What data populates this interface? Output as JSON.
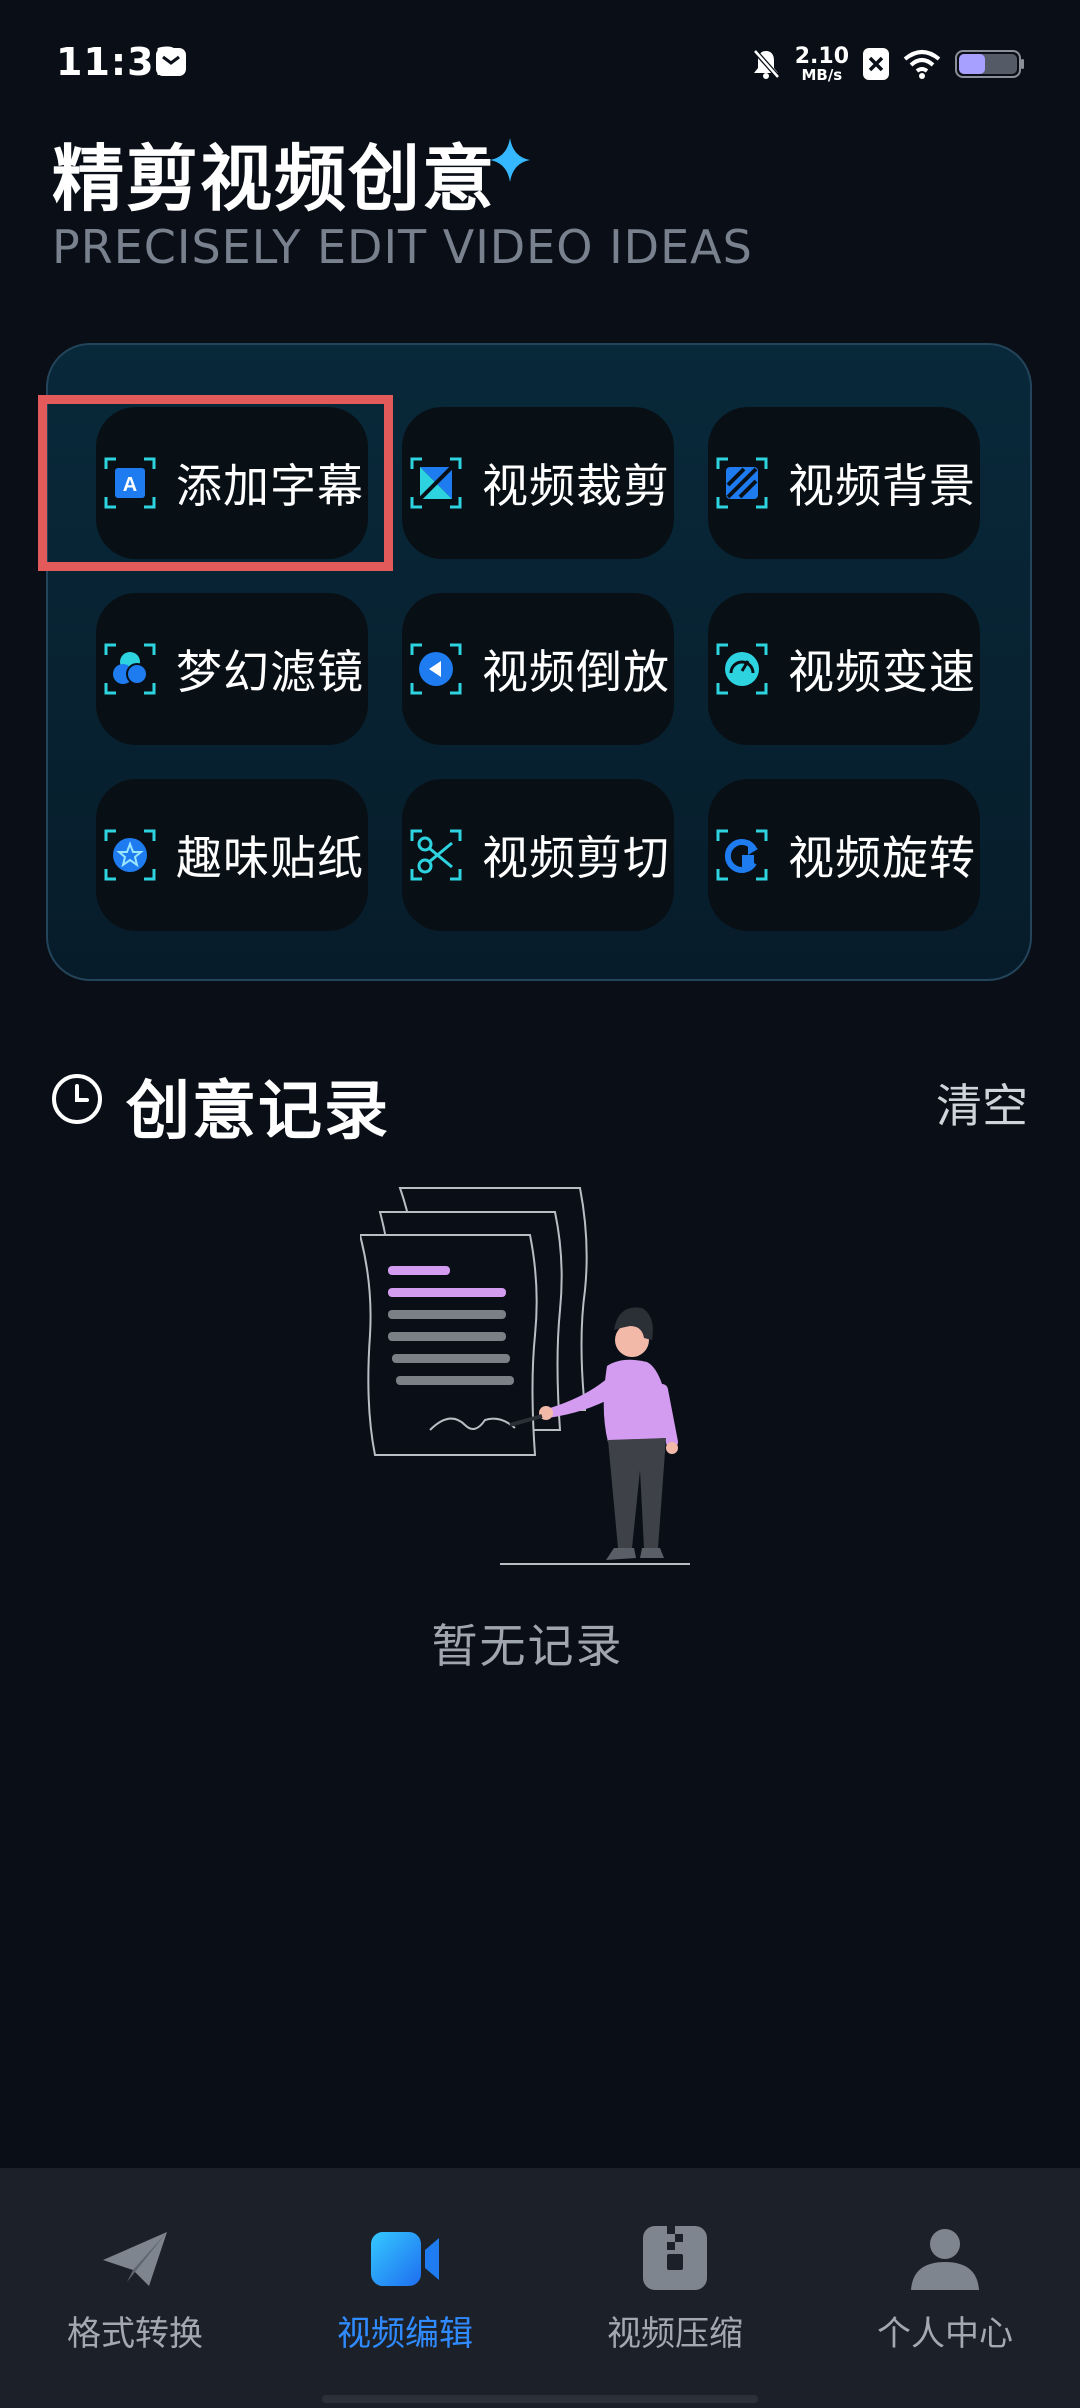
{
  "status_bar": {
    "time": "11:32",
    "net_speed_value": "2.10",
    "net_speed_unit": "MB/s",
    "icons": [
      "notification-icon",
      "bell-off-icon",
      "sim-x-icon",
      "wifi-icon",
      "battery-icon"
    ]
  },
  "header": {
    "title": "精剪视频创意",
    "subtitle": "PRECISELY EDIT VIDEO IDEAS",
    "accent": "#35b8ff"
  },
  "tools": [
    {
      "label": "添加字幕",
      "icon": "subtitle-icon"
    },
    {
      "label": "视频裁剪",
      "icon": "crop-icon"
    },
    {
      "label": "视频背景",
      "icon": "background-icon"
    },
    {
      "label": "梦幻滤镜",
      "icon": "filter-icon"
    },
    {
      "label": "视频倒放",
      "icon": "reverse-icon"
    },
    {
      "label": "视频变速",
      "icon": "speed-icon"
    },
    {
      "label": "趣味贴纸",
      "icon": "sticker-icon"
    },
    {
      "label": "视频剪切",
      "icon": "scissors-icon"
    },
    {
      "label": "视频旋转",
      "icon": "rotate-icon"
    }
  ],
  "records": {
    "title": "创意记录",
    "clear_label": "清空",
    "empty_text": "暂无记录"
  },
  "nav": {
    "items": [
      {
        "label": "格式转换",
        "icon": "paper-plane-icon"
      },
      {
        "label": "视频编辑",
        "icon": "video-camera-icon",
        "active": true
      },
      {
        "label": "视频压缩",
        "icon": "zip-icon"
      },
      {
        "label": "个人中心",
        "icon": "person-icon"
      }
    ],
    "active_color": "#2f8bff",
    "inactive_color": "#a3a8b1"
  }
}
